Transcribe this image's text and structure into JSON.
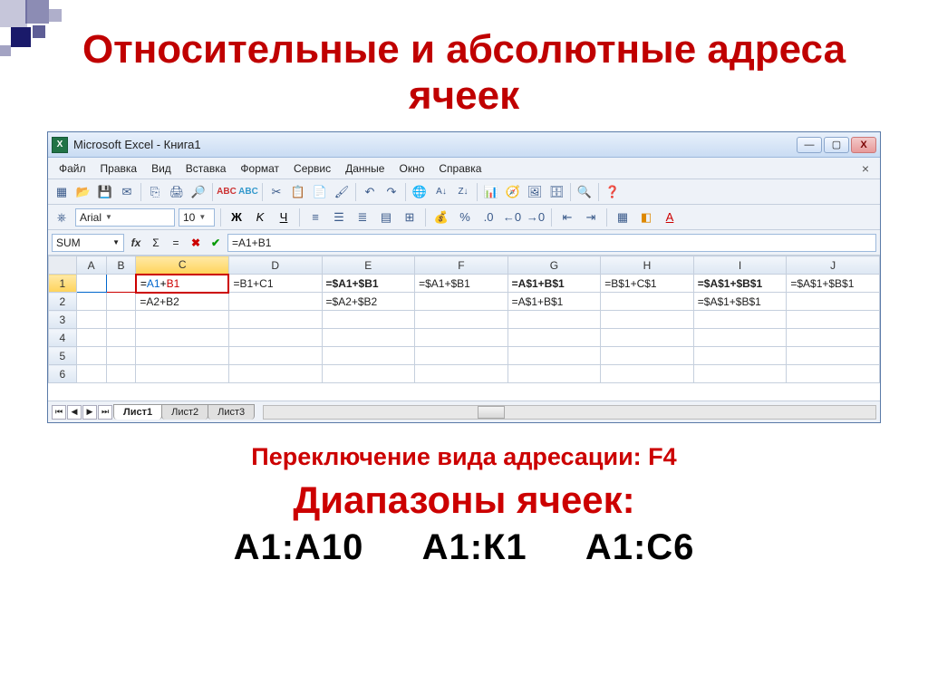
{
  "slide": {
    "title": "Относительные и абсолютные адреса ячеек",
    "subtitle1": "Переключение вида адресации:  F4",
    "subtitle2": "Диапазоны ячеек:",
    "ranges": {
      "r1": "А1:А10",
      "r2": "А1:К1",
      "r3": "А1:С6"
    }
  },
  "excel": {
    "window_title": "Microsoft Excel - Книга1",
    "menubar": [
      "Файл",
      "Правка",
      "Вид",
      "Вставка",
      "Формат",
      "Сервис",
      "Данные",
      "Окно",
      "Справка"
    ],
    "font_name": "Arial",
    "font_size": "10",
    "name_box": "SUM",
    "formula": "=A1+B1",
    "columns": [
      "A",
      "B",
      "C",
      "D",
      "E",
      "F",
      "G",
      "H",
      "I",
      "J"
    ],
    "rows": [
      "1",
      "2",
      "3",
      "4",
      "5",
      "6"
    ],
    "cells": {
      "C1": "=A1+B1",
      "D1": "=B1+C1",
      "E1": "=$A1+$B1",
      "F1": "=$A1+$B1",
      "G1": "=A$1+B$1",
      "H1": "=B$1+C$1",
      "I1": "=$A$1+$B$1",
      "J1": "=$A$1+$B$1",
      "C2": "=A2+B2",
      "E2": "=$A2+$B2",
      "G2": "=A$1+B$1",
      "I2": "=$A$1+$B$1"
    },
    "tabs": [
      "Лист1",
      "Лист2",
      "Лист3"
    ]
  },
  "icons": {
    "save": "💾",
    "print": "🖨",
    "cut": "✂",
    "copy": "📋",
    "paste": "📄",
    "undo": "↶",
    "redo": "↷",
    "chart": "📊",
    "help": "❓",
    "search": "🔍",
    "sort_az": "A↓",
    "sort_za": "Z↓"
  }
}
